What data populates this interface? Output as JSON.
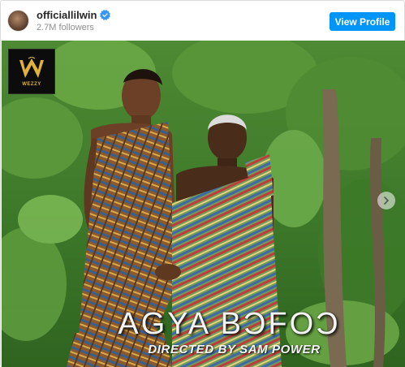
{
  "header": {
    "username": "officiallilwin",
    "verified_icon": "verified-badge-icon",
    "followers": "2.7M followers",
    "view_profile_label": "View Profile"
  },
  "media": {
    "logo_text": "WEZZY",
    "title": "AGYA BƆFOƆ",
    "subtitle": "DIRECTED BY SAM POWER",
    "next_icon": "chevron-right-icon"
  },
  "colors": {
    "accent": "#0095f6",
    "verified": "#3897f0",
    "muted_text": "#8e8e8e"
  }
}
